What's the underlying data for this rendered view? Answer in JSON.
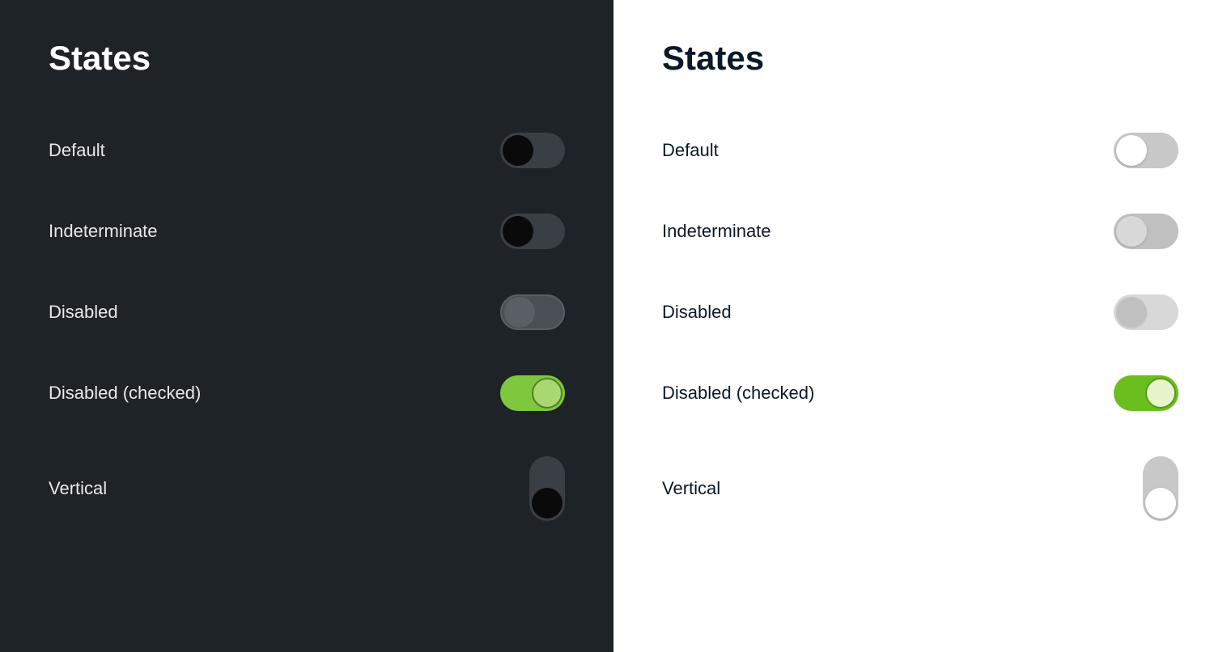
{
  "dark_panel": {
    "title": "States",
    "states": [
      {
        "id": "default",
        "label": "Default"
      },
      {
        "id": "indeterminate",
        "label": "Indeterminate"
      },
      {
        "id": "disabled",
        "label": "Disabled"
      },
      {
        "id": "disabled-checked",
        "label": "Disabled (checked)"
      },
      {
        "id": "vertical",
        "label": "Vertical"
      }
    ]
  },
  "light_panel": {
    "title": "States",
    "states": [
      {
        "id": "default",
        "label": "Default"
      },
      {
        "id": "indeterminate",
        "label": "Indeterminate"
      },
      {
        "id": "disabled",
        "label": "Disabled"
      },
      {
        "id": "disabled-checked",
        "label": "Disabled (checked)"
      },
      {
        "id": "vertical",
        "label": "Vertical"
      }
    ]
  }
}
